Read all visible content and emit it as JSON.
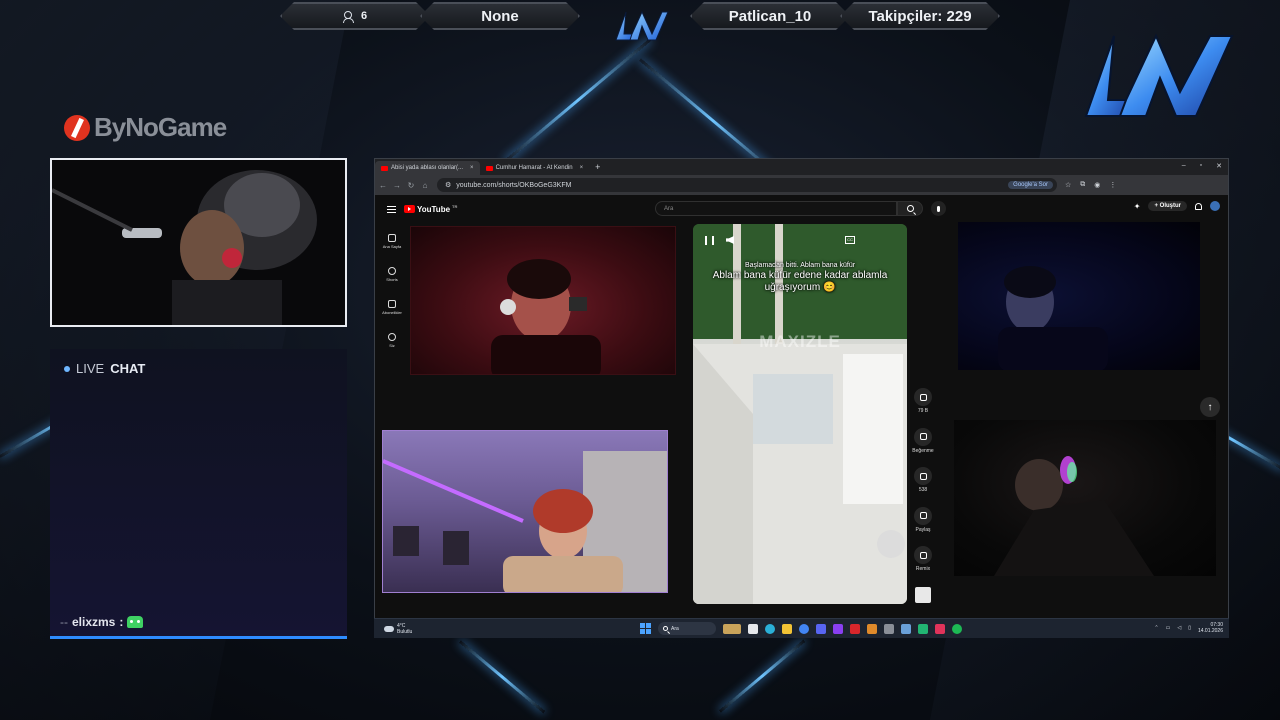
{
  "topbar": {
    "viewers": "6",
    "game": "None",
    "streamer": "Patlican_10",
    "followers": "Takipçiler: 229"
  },
  "sponsor": {
    "name": "ByNoGame"
  },
  "chat": {
    "title_live": "LIVE",
    "title_chat": "CHAT",
    "messages": [
      {
        "prefix": "--",
        "user": "elixzms",
        "sep": ":"
      }
    ]
  },
  "browser": {
    "tabs": [
      {
        "title": "Abisi yada ablası olanlar(...",
        "active": true
      },
      {
        "title": "Cumhur Hamarat - At Kendin",
        "active": false
      }
    ],
    "new_tab": "+",
    "url": "youtube.com/shorts/OKBoGeG3KFM",
    "ai_button": "Google'a Sor"
  },
  "youtube": {
    "logo": "YouTube",
    "logo_region": "TR",
    "search_placeholder": "Ara",
    "create_label": "Oluştur",
    "sidebar": [
      {
        "label": "Ana Sayfa",
        "icon": "home-icon"
      },
      {
        "label": "Shorts",
        "icon": "shorts-icon"
      },
      {
        "label": "Abonelikler",
        "icon": "subscriptions-icon"
      },
      {
        "label": "Siz",
        "icon": "you-icon"
      }
    ]
  },
  "short": {
    "caption_small": "Başlamadan bitti. Ablam bana küfür",
    "caption_big": "Ablam bana küfür edene kadar ablamla uğraşıyorum 😊",
    "watermark": "MAXIZLE",
    "actions": [
      {
        "label": "79 B",
        "icon": "like-icon"
      },
      {
        "label": "Beğenme",
        "icon": "dislike-icon"
      },
      {
        "label": "538",
        "icon": "comment-icon"
      },
      {
        "label": "Paylaş",
        "icon": "share-icon"
      },
      {
        "label": "Remix",
        "icon": "remix-icon"
      }
    ]
  },
  "taskbar": {
    "temp": "4°C",
    "weather": "Bulutlu",
    "search": "Ara",
    "time": "07:30",
    "date": "14.01.2026"
  },
  "colors": {
    "accent_blue": "#2e8cff",
    "youtube_red": "#ff0000",
    "bynogame_red": "#e0331f",
    "chat_bg": "#151432"
  }
}
